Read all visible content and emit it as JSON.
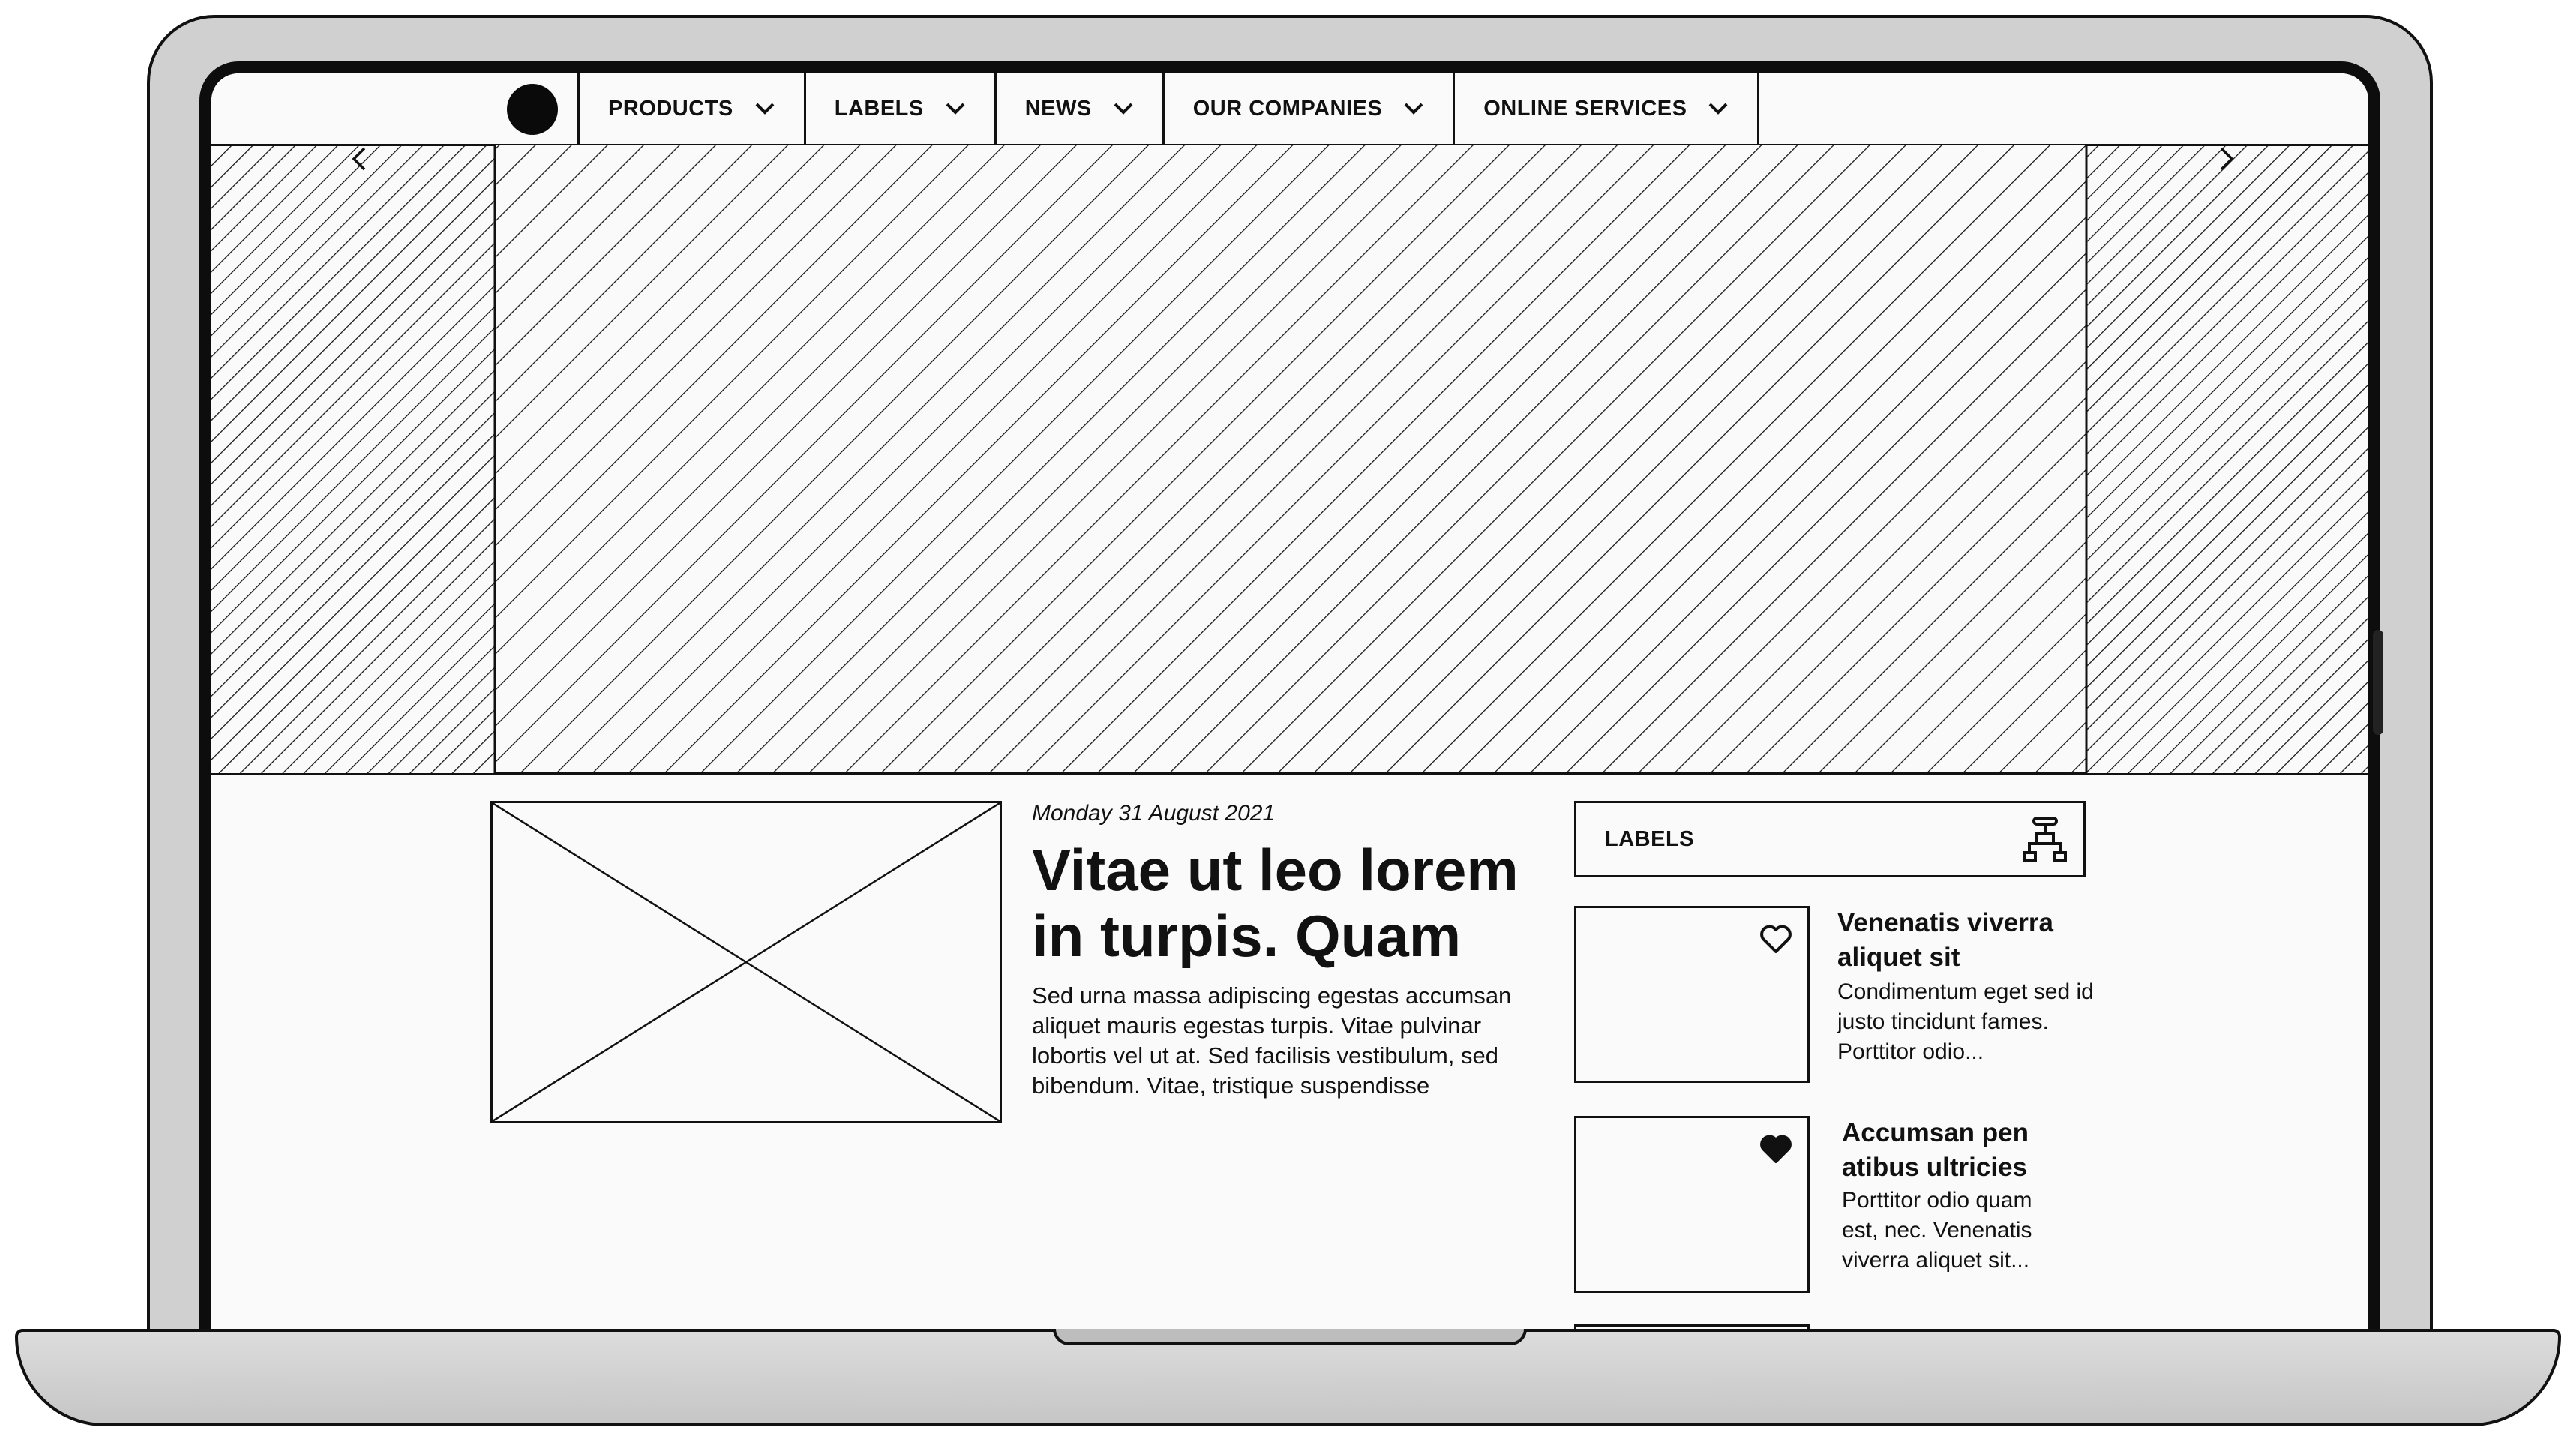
{
  "nav": {
    "items": [
      {
        "label": "PRODUCTS",
        "icon": "chevron-down-icon"
      },
      {
        "label": "LABELS",
        "icon": "chevron-down-icon"
      },
      {
        "label": "NEWS",
        "icon": "chevron-down-icon"
      },
      {
        "label": "OUR COMPANIES",
        "icon": "chevron-down-icon"
      },
      {
        "label": "ONLINE SERVICES",
        "icon": "chevron-down-icon"
      }
    ]
  },
  "hero": {
    "prev_icon": "chevron-left-icon",
    "next_icon": "chevron-right-icon"
  },
  "article": {
    "date": "Monday 31 August 2021",
    "title": "Vitae ut leo lorem in turpis. Quam",
    "excerpt": "Sed urna massa adipiscing egestas accumsan aliquet mauris egestas turpis. Vitae pulvinar lobortis vel ut at. Sed facilisis vestibulum, sed bibendum. Vitae, tristique suspendisse"
  },
  "sidebar": {
    "title": "LABELS",
    "icon": "valve-icon",
    "cards": [
      {
        "title": "Venenatis viverra aliquet sit",
        "text": "Condimentum eget sed id justo tincidunt fames. Porttitor odio...",
        "favorite": false
      },
      {
        "title": "Accumsan pen atibus ultricies",
        "text": "Porttitor odio quam est, nec. Venenatis viverra aliquet sit...",
        "favorite": true
      }
    ]
  }
}
